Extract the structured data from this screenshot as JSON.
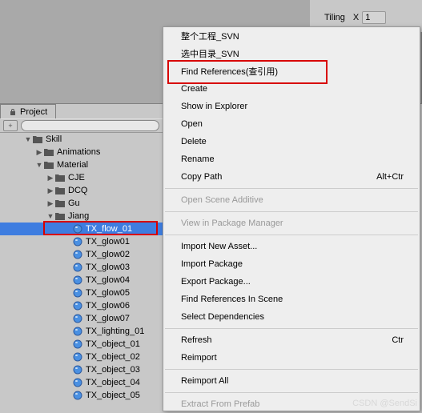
{
  "inspector": {
    "tiling_label": "Tiling",
    "x_label": "X",
    "x_value": "1"
  },
  "project": {
    "tab_label": "Project",
    "search_placeholder": ""
  },
  "tree": [
    {
      "indent": 30,
      "arrow": "down",
      "icon": "folder",
      "label": "Skill"
    },
    {
      "indent": 44,
      "arrow": "right",
      "icon": "folder",
      "label": "Animations"
    },
    {
      "indent": 44,
      "arrow": "down",
      "icon": "folder",
      "label": "Material"
    },
    {
      "indent": 58,
      "arrow": "right",
      "icon": "folder",
      "label": "CJE"
    },
    {
      "indent": 58,
      "arrow": "right",
      "icon": "folder",
      "label": "DCQ"
    },
    {
      "indent": 58,
      "arrow": "right",
      "icon": "folder",
      "label": "Gu"
    },
    {
      "indent": 58,
      "arrow": "down",
      "icon": "folder",
      "label": "Jiang"
    },
    {
      "indent": 80,
      "arrow": "",
      "icon": "material",
      "label": "TX_flow_01",
      "selected": true
    },
    {
      "indent": 80,
      "arrow": "",
      "icon": "material",
      "label": "TX_glow01"
    },
    {
      "indent": 80,
      "arrow": "",
      "icon": "material",
      "label": "TX_glow02"
    },
    {
      "indent": 80,
      "arrow": "",
      "icon": "material",
      "label": "TX_glow03"
    },
    {
      "indent": 80,
      "arrow": "",
      "icon": "material",
      "label": "TX_glow04"
    },
    {
      "indent": 80,
      "arrow": "",
      "icon": "material",
      "label": "TX_glow05"
    },
    {
      "indent": 80,
      "arrow": "",
      "icon": "material",
      "label": "TX_glow06"
    },
    {
      "indent": 80,
      "arrow": "",
      "icon": "material",
      "label": "TX_glow07"
    },
    {
      "indent": 80,
      "arrow": "",
      "icon": "material",
      "label": "TX_lighting_01"
    },
    {
      "indent": 80,
      "arrow": "",
      "icon": "material",
      "label": "TX_object_01"
    },
    {
      "indent": 80,
      "arrow": "",
      "icon": "material",
      "label": "TX_object_02"
    },
    {
      "indent": 80,
      "arrow": "",
      "icon": "material",
      "label": "TX_object_03"
    },
    {
      "indent": 80,
      "arrow": "",
      "icon": "material",
      "label": "TX_object_04"
    },
    {
      "indent": 80,
      "arrow": "",
      "icon": "material",
      "label": "TX_object_05"
    }
  ],
  "menu": [
    {
      "type": "item",
      "label": "整个工程_SVN",
      "shortcut": ""
    },
    {
      "type": "item",
      "label": "选中目录_SVN",
      "shortcut": ""
    },
    {
      "type": "item",
      "label": "Find References(查引用)",
      "shortcut": "",
      "highlight": true
    },
    {
      "type": "item",
      "label": "Create",
      "shortcut": ""
    },
    {
      "type": "item",
      "label": "Show in Explorer",
      "shortcut": ""
    },
    {
      "type": "item",
      "label": "Open",
      "shortcut": ""
    },
    {
      "type": "item",
      "label": "Delete",
      "shortcut": ""
    },
    {
      "type": "item",
      "label": "Rename",
      "shortcut": ""
    },
    {
      "type": "item",
      "label": "Copy Path",
      "shortcut": "Alt+Ctr"
    },
    {
      "type": "sep"
    },
    {
      "type": "item",
      "label": "Open Scene Additive",
      "shortcut": "",
      "disabled": true
    },
    {
      "type": "sep"
    },
    {
      "type": "item",
      "label": "View in Package Manager",
      "shortcut": "",
      "disabled": true
    },
    {
      "type": "sep"
    },
    {
      "type": "item",
      "label": "Import New Asset...",
      "shortcut": ""
    },
    {
      "type": "item",
      "label": "Import Package",
      "shortcut": ""
    },
    {
      "type": "item",
      "label": "Export Package...",
      "shortcut": ""
    },
    {
      "type": "item",
      "label": "Find References In Scene",
      "shortcut": ""
    },
    {
      "type": "item",
      "label": "Select Dependencies",
      "shortcut": ""
    },
    {
      "type": "sep"
    },
    {
      "type": "item",
      "label": "Refresh",
      "shortcut": "Ctr"
    },
    {
      "type": "item",
      "label": "Reimport",
      "shortcut": ""
    },
    {
      "type": "sep"
    },
    {
      "type": "item",
      "label": "Reimport All",
      "shortcut": ""
    },
    {
      "type": "sep"
    },
    {
      "type": "item",
      "label": "Extract From Prefab",
      "shortcut": "",
      "disabled": true
    }
  ],
  "watermark": "CSDN @SendSi"
}
